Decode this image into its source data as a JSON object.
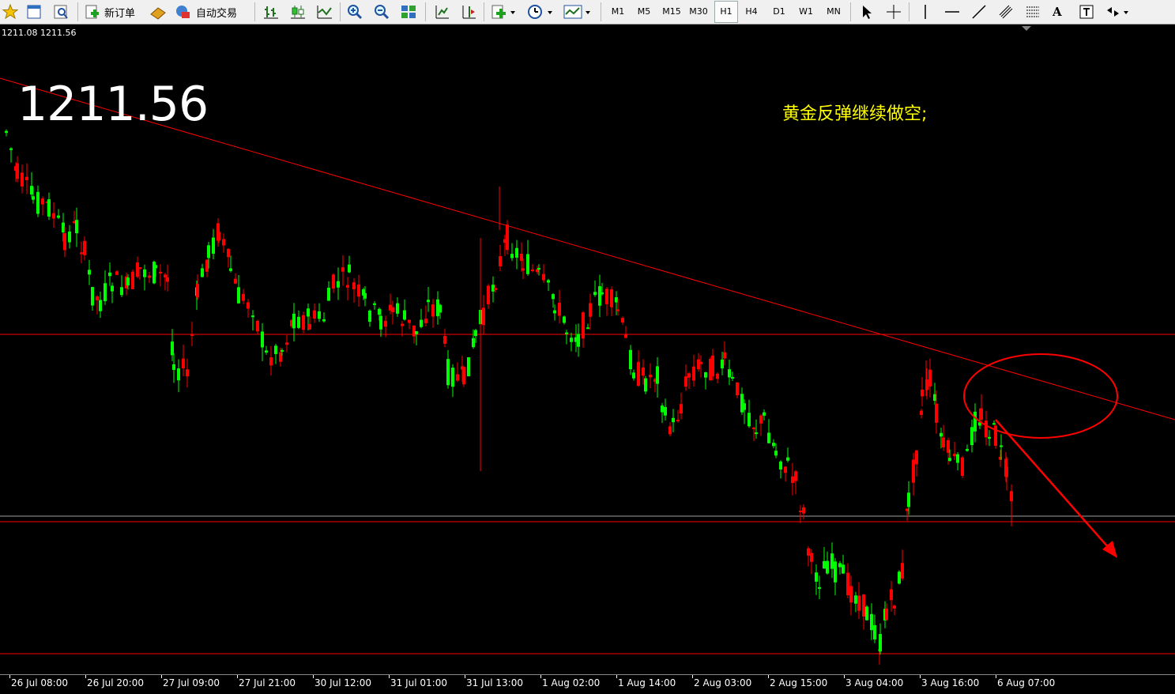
{
  "toolbar": {
    "new_order_label": "新订单",
    "auto_trade_label": "自动交易",
    "timeframes": [
      "M1",
      "M5",
      "M15",
      "M30",
      "H1",
      "H4",
      "D1",
      "W1",
      "MN"
    ],
    "text_tool_label": "A"
  },
  "chart": {
    "quote_line": "1211.08 1211.56",
    "big_price": "1211.56",
    "annotation": "黄金反弹继续做空;",
    "time_labels": [
      "26 Jul 08:00",
      "26 Jul 20:00",
      "27 Jul 09:00",
      "27 Jul 21:00",
      "30 Jul 12:00",
      "31 Jul 01:00",
      "31 Jul 13:00",
      "1 Aug 02:00",
      "1 Aug 14:00",
      "2 Aug 03:00",
      "2 Aug 15:00",
      "3 Aug 04:00",
      "3 Aug 16:00",
      "6 Aug 07:00"
    ],
    "colors": {
      "bull": "#ff0000",
      "bear": "#00ff00",
      "line": "#ff0000",
      "annotation": "#ffff00"
    }
  }
}
